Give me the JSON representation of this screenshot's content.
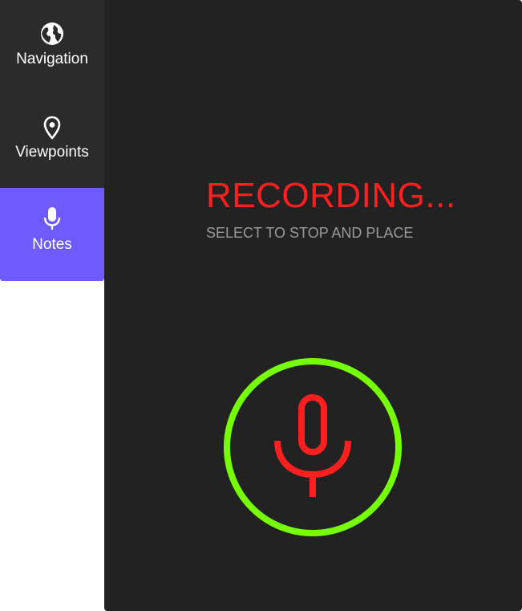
{
  "sidebar": {
    "items": [
      {
        "label": "Navigation",
        "icon": "globe-icon",
        "active": false
      },
      {
        "label": "Viewpoints",
        "icon": "map-pin-icon",
        "active": false
      },
      {
        "label": "Notes",
        "icon": "microphone-icon",
        "active": true
      }
    ]
  },
  "main": {
    "status_title": "RECORDING...",
    "status_subtitle": "SELECT TO STOP AND PLACE",
    "record_button_icon": "microphone-icon"
  },
  "colors": {
    "sidebar_bg": "#2b2b2b",
    "active_bg": "#6e5aff",
    "panel_bg": "#222222",
    "recording_red": "#ff1f1f",
    "ring_green": "#76ff00",
    "subtitle_gray": "#9a9a9a"
  }
}
